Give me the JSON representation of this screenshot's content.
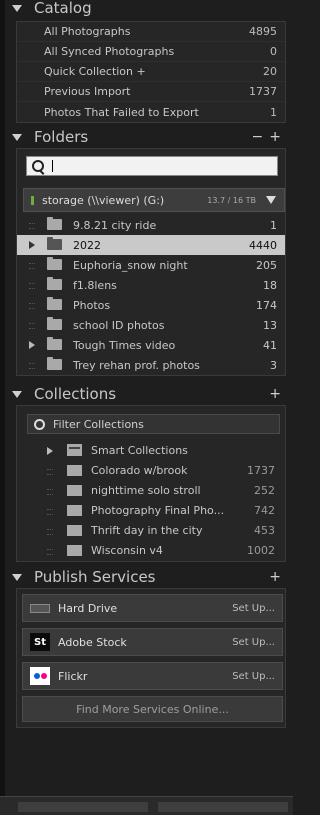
{
  "catalog": {
    "title": "Catalog",
    "items": [
      {
        "label": "All Photographs",
        "count": "4895"
      },
      {
        "label": "All Synced Photographs",
        "count": "0"
      },
      {
        "label": "Quick Collection +",
        "count": "20"
      },
      {
        "label": "Previous Import",
        "count": "1737"
      },
      {
        "label": "Photos That Failed to Export",
        "count": "1"
      }
    ]
  },
  "folders": {
    "title": "Folders",
    "minus": "−",
    "plus": "+",
    "search_value": "",
    "volume": {
      "name": "storage (\\\\viewer) (G:)",
      "size": "13.7 / 16 TB"
    },
    "items": [
      {
        "label": "9.8.21 city ride",
        "count": "1"
      },
      {
        "label": "2022",
        "count": "4440"
      },
      {
        "label": "Euphoria_snow night",
        "count": "205"
      },
      {
        "label": "f1.8lens",
        "count": "18"
      },
      {
        "label": "Photos",
        "count": "174"
      },
      {
        "label": "school ID photos",
        "count": "13"
      },
      {
        "label": "Tough Times video",
        "count": "41"
      },
      {
        "label": "Trey rehan prof. photos",
        "count": "3"
      }
    ]
  },
  "collections": {
    "title": "Collections",
    "plus": "+",
    "filter_label": "Filter Collections",
    "smart_label": "Smart Collections",
    "items": [
      {
        "label": "Colorado w/brook",
        "count": "1737"
      },
      {
        "label": "nighttime solo stroll",
        "count": "252"
      },
      {
        "label": "Photography Final Pho...",
        "count": "742"
      },
      {
        "label": "Thrift day in the city",
        "count": "453"
      },
      {
        "label": "Wisconsin v4",
        "count": "1002"
      }
    ]
  },
  "publish": {
    "title": "Publish Services",
    "plus": "+",
    "services": [
      {
        "name": "Hard Drive",
        "action": "Set Up...",
        "icon": "hard-drive-icon"
      },
      {
        "name": "Adobe Stock",
        "action": "Set Up...",
        "icon": "adobe-stock-icon",
        "icon_text": "St"
      },
      {
        "name": "Flickr",
        "action": "Set Up...",
        "icon": "flickr-icon"
      }
    ],
    "find_more": "Find More Services Online..."
  }
}
